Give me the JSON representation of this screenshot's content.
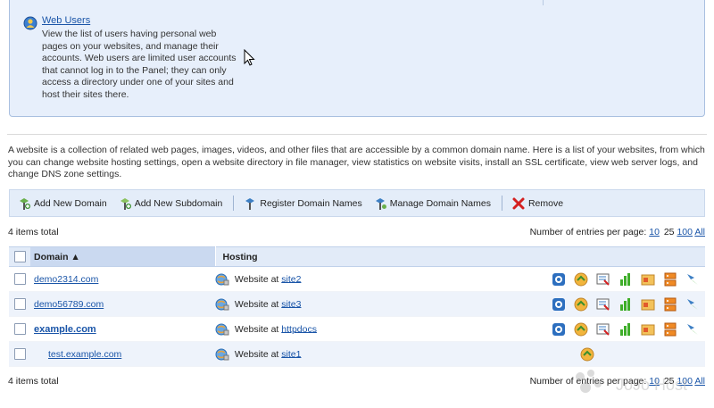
{
  "info": {
    "web_users_title": "Web Users",
    "web_users_desc": "View the list of users having personal web pages on your websites, and manage their accounts. Web users are limited user accounts that cannot log in to the Panel; they can only access a directory under one of your sites and host their sites there."
  },
  "intro_text": "A website is a collection of related web pages, images, videos, and other files that are accessible by a common domain name. Here is a list of your websites, from which you can change website hosting settings, open a website directory in file manager, view statistics on website visits, install an SSL certificate, view web server logs, and change DNS zone settings.",
  "toolbar": {
    "add_domain": "Add New Domain",
    "add_subdomain": "Add New Subdomain",
    "register": "Register Domain Names",
    "manage": "Manage Domain Names",
    "remove": "Remove"
  },
  "summary": {
    "total": "4 items total",
    "per_page_label": "Number of entries per page:",
    "opt10": "10",
    "opt25": "25",
    "opt100": "100",
    "opt_all": "All"
  },
  "table": {
    "col_domain": "Domain ▲",
    "col_hosting": "Hosting",
    "rows": [
      {
        "domain": "demo2314.com",
        "hosting_prefix": "Website at",
        "site": "site2"
      },
      {
        "domain": "demo56789.com",
        "hosting_prefix": "Website at",
        "site": "site3"
      },
      {
        "domain": "example.com",
        "hosting_prefix": "Website at",
        "site": "httpdocs"
      },
      {
        "domain": "test.example.com",
        "hosting_prefix": "Website at",
        "site": "site1"
      }
    ]
  },
  "watermark": "JoJo Host",
  "colors": {
    "link": "#1a55a8",
    "info_bg": "#e7effb",
    "toolbar_bg": "#e4edf9",
    "header_bg": "#e2ebf8",
    "alt_row": "#eef3fb"
  }
}
